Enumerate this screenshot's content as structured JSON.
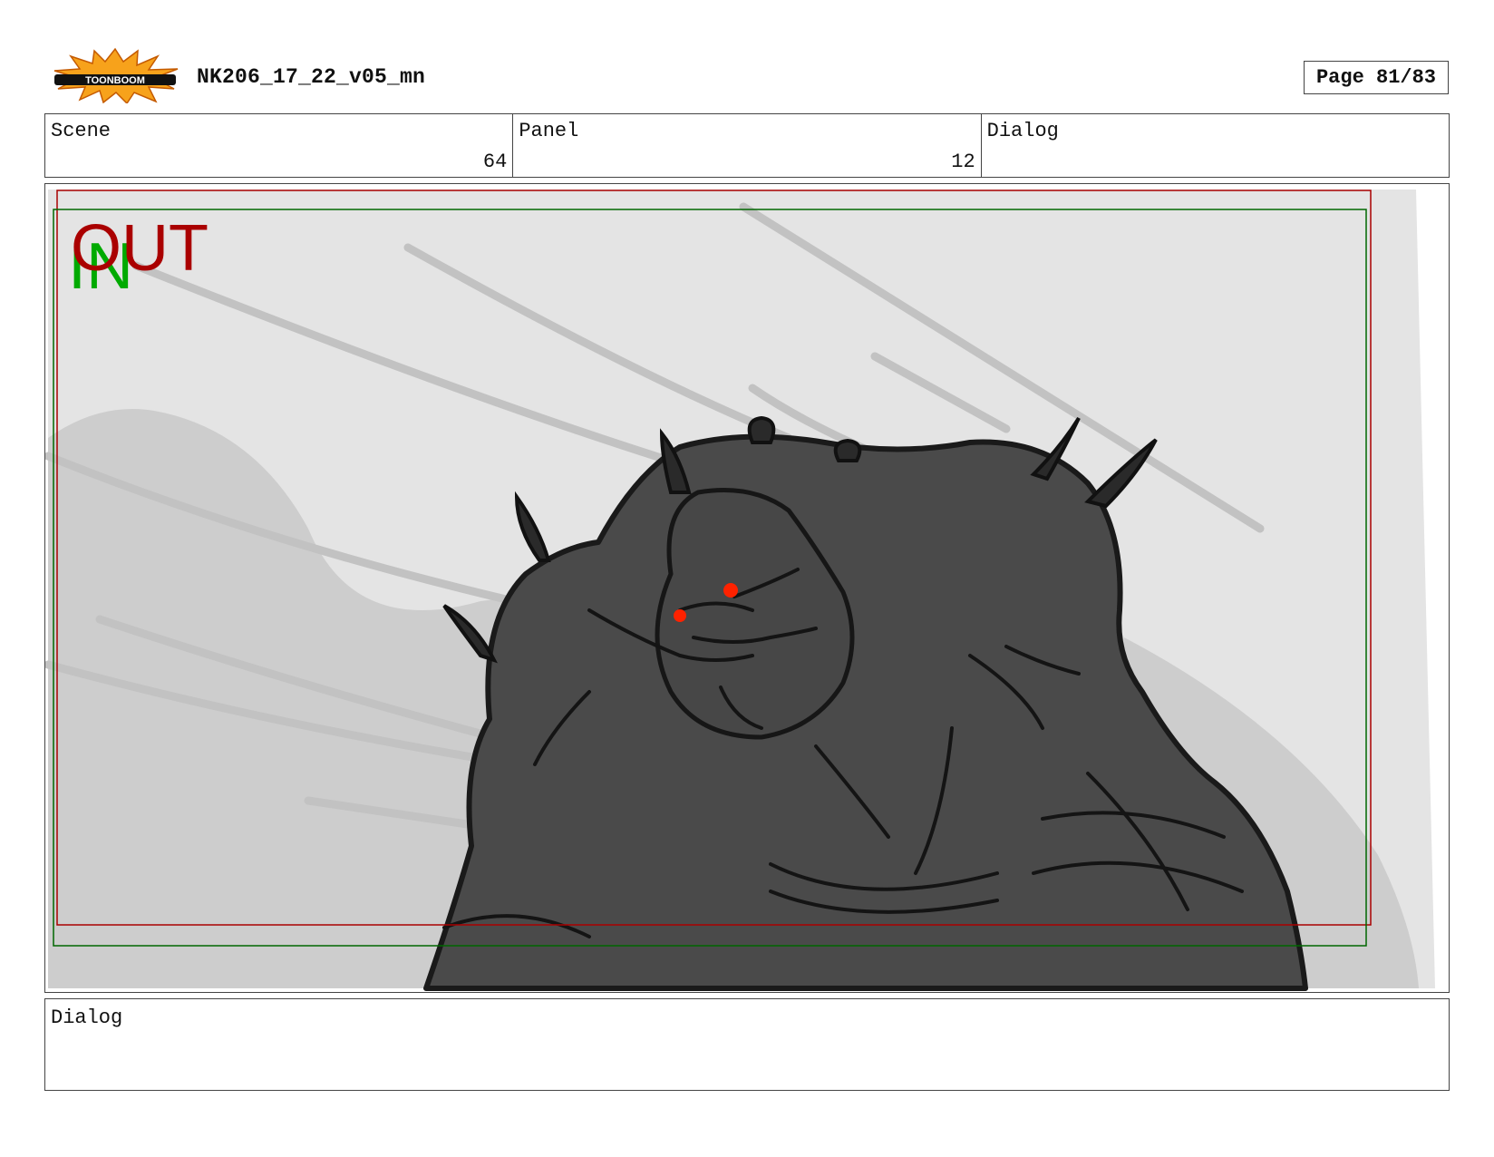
{
  "header": {
    "logo_text": "TOONBOOM",
    "doc_title": "NK206_17_22_v05_mn",
    "page_label": "Page 81/83"
  },
  "info": {
    "scene_label": "Scene",
    "scene_value": "64",
    "panel_label": "Panel",
    "panel_value": "12",
    "dialog_label": "Dialog",
    "dialog_value": ""
  },
  "panel": {
    "out_marker": "OUT",
    "in_marker": "IN",
    "out_color": "#aa0000",
    "in_color": "#00aa00",
    "eye_color": "#ff2200"
  },
  "dialog_section": {
    "label": "Dialog",
    "text": ""
  }
}
